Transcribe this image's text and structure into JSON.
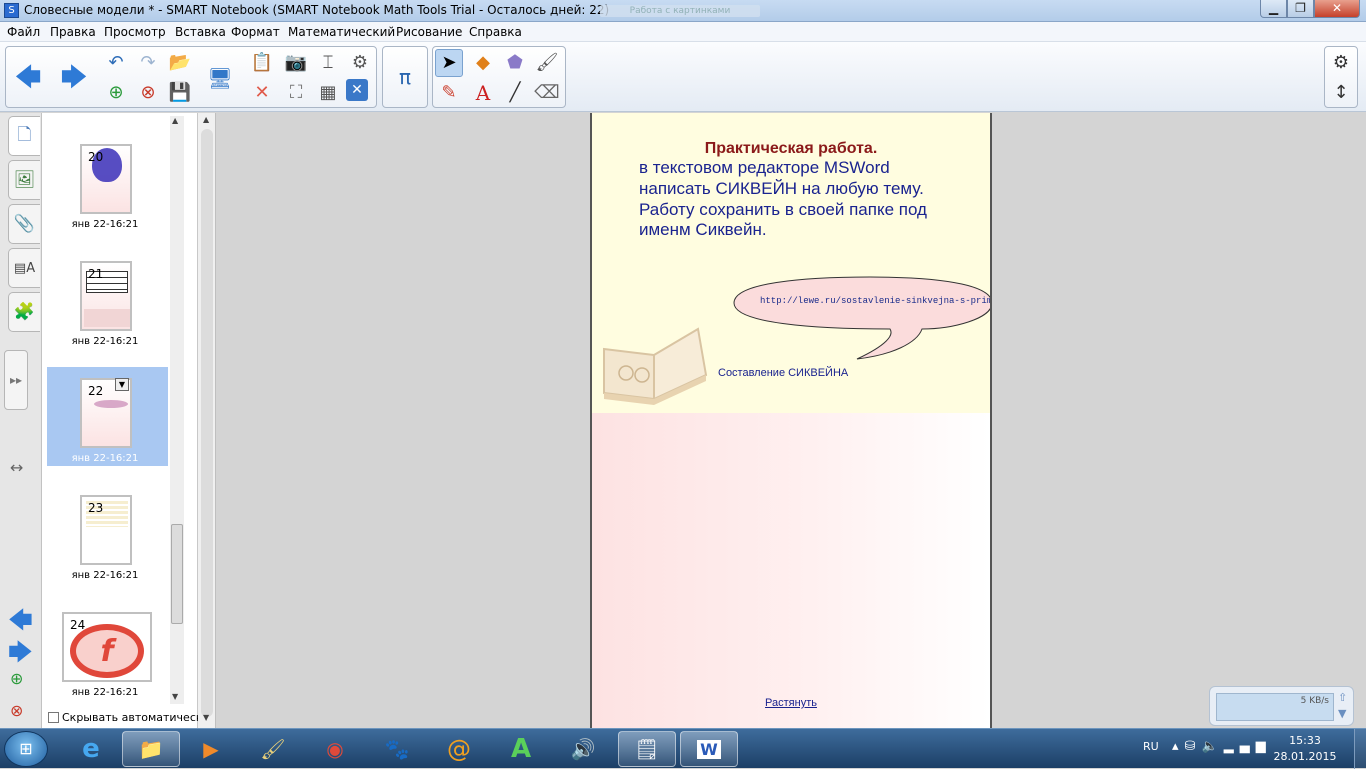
{
  "window": {
    "title": "Словесные модели * - SMART Notebook (SMART Notebook Math Tools Trial - Осталось дней: 22)",
    "ghost_title": "Работа с картинками"
  },
  "menu": [
    "Файл",
    "Правка",
    "Просмотр",
    "Вставка",
    "Формат",
    "Математический",
    "Рисование",
    "Справка"
  ],
  "toolbar": {
    "icons": {
      "back": "arrow-left-icon",
      "forward": "arrow-right-icon",
      "undo": "undo-icon",
      "redo": "redo-icon",
      "open": "folder-icon",
      "add_page": "add-page-icon",
      "delete_page": "delete-page-icon",
      "save": "save-icon",
      "screen_shade": "screen-shade-icon",
      "paste": "paste-icon",
      "delete": "delete-icon",
      "screen_capture": "camera-icon",
      "full_screen": "full-screen-icon",
      "table": "table-icon",
      "clear": "clear-icon",
      "tools": "tools-icon",
      "math": "pi-icon",
      "select": "select-arrow-icon",
      "shapes": "shapes-icon",
      "eraser_shape": "eraser-icon",
      "fill": "fill-icon",
      "pens": "pens-icon",
      "text": "text-icon",
      "line": "line-icon",
      "eraser": "eraser2-icon",
      "settings": "gear-icon",
      "move_toolbar": "updown-icon"
    },
    "glyph_pi": "π",
    "glyph_text": "A"
  },
  "sorter": {
    "pages": [
      {
        "num": "20",
        "label": "янв 22-16:21"
      },
      {
        "num": "21",
        "label": "янв 22-16:21"
      },
      {
        "num": "22",
        "label": "янв 22-16:21"
      },
      {
        "num": "23",
        "label": "янв 22-16:21"
      },
      {
        "num": "24",
        "label": "янв 22-16:21"
      }
    ],
    "selected_index": 2,
    "autohide_label": "Скрывать автоматическ",
    "autohide_checked": false
  },
  "page": {
    "title": "Практическая работа.",
    "lines": [
      "в текстовом редакторе MSWord",
      "написать СИКВЕЙН на любую тему.",
      "Работу сохранить в своей папке под",
      "именм Сиквейн."
    ],
    "link": "http://lewe.ru/sostavlenie-sinkvejna-s-primerami/",
    "caption": "Составление СИКВЕЙНА",
    "stretch_label": "Растянуть"
  },
  "net_meter": {
    "speed": "5 KB/s"
  },
  "taskbar": {
    "apps": [
      "ie-icon",
      "explorer-icon",
      "media-player-icon",
      "paint-icon",
      "chrome-icon",
      "gimp-icon",
      "mail-at-icon",
      "font-a-icon",
      "volume-app-icon",
      "smart-notebook-icon",
      "word-icon"
    ],
    "lang": "RU",
    "time": "15:33",
    "date": "28.01.2015"
  },
  "colors": {
    "accent": "#bcd6f2",
    "page_title": "#8b1a1a",
    "page_text": "#1a238f",
    "bubble_fill": "#fbdcdc"
  }
}
